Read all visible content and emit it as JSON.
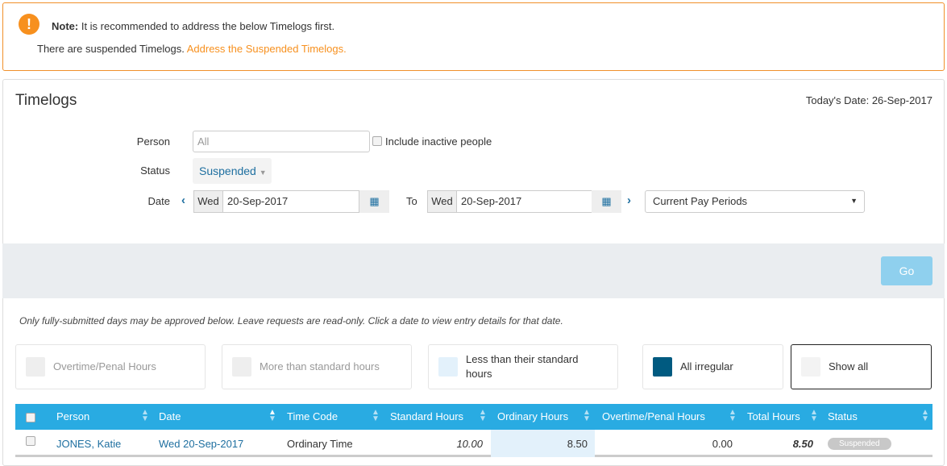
{
  "alert": {
    "icon": "exclamation-icon",
    "note_label": "Note:",
    "note_text": " It is recommended to address the below Timelogs first.",
    "message": "There are suspended Timelogs.",
    "link": "Address the Suspended Timelogs."
  },
  "page": {
    "title": "Timelogs",
    "today_label": "Today's Date: 26-Sep-2017"
  },
  "filters": {
    "person_label": "Person",
    "person_placeholder": "All",
    "include_inactive": "Include inactive people",
    "status_label": "Status",
    "status_value": "Suspended",
    "date_label": "Date",
    "from_day": "Wed",
    "from_date": "20-Sep-2017",
    "to_label": "To",
    "to_day": "Wed",
    "to_date": "20-Sep-2017",
    "period_value": "Current Pay Periods",
    "go": "Go"
  },
  "info": "Only fully-submitted days may be approved below. Leave requests are read-only. Click a date to view entry details for that date.",
  "legend": [
    {
      "label": "Overtime/Penal Hours",
      "color": "#eeeeee"
    },
    {
      "label": "More than standard hours",
      "color": "#eeeeee"
    },
    {
      "label": "Less than their standard hours",
      "color": "#e3f1fb"
    },
    {
      "label": "All irregular",
      "color": "#005a80"
    },
    {
      "label": "Show all",
      "color": "#f3f3f3"
    }
  ],
  "table": {
    "columns": [
      "Person",
      "Date",
      "Time Code",
      "Standard Hours",
      "Ordinary Hours",
      "Overtime/Penal Hours",
      "Total Hours",
      "Status"
    ],
    "rows": [
      {
        "person": "JONES, Katie",
        "date": "Wed 20-Sep-2017",
        "time_code": "Ordinary Time",
        "standard": "10.00",
        "ordinary": "8.50",
        "overtime": "0.00",
        "total": "8.50",
        "status": "Suspended"
      }
    ]
  },
  "colors": {
    "accent": "#f7901e",
    "header": "#29abe2",
    "link": "#1e6fa0"
  }
}
